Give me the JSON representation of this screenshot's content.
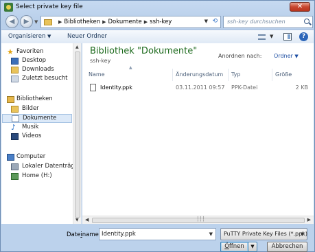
{
  "window": {
    "title": "Select private key file"
  },
  "address": {
    "crumbs": [
      "Bibliotheken",
      "Dokumente",
      "ssh-key"
    ],
    "search_placeholder": "ssh-key durchsuchen"
  },
  "toolbar": {
    "organize": "Organisieren",
    "new_folder": "Neuer Ordner"
  },
  "nav": {
    "favorites": {
      "label": "Favoriten",
      "items": [
        {
          "label": "Desktop",
          "icon": "desktop-icon"
        },
        {
          "label": "Downloads",
          "icon": "downloads-folder-icon"
        },
        {
          "label": "Zuletzt besucht",
          "icon": "recent-places-icon"
        }
      ]
    },
    "libraries": {
      "label": "Bibliotheken",
      "items": [
        {
          "label": "Bilder",
          "icon": "pictures-icon"
        },
        {
          "label": "Dokumente",
          "icon": "documents-icon",
          "selected": true
        },
        {
          "label": "Musik",
          "icon": "music-icon"
        },
        {
          "label": "Videos",
          "icon": "videos-icon"
        }
      ]
    },
    "computer": {
      "label": "Computer",
      "items": [
        {
          "label": "Lokaler Datenträg",
          "icon": "local-drive-icon"
        },
        {
          "label": "Home (H:)",
          "icon": "network-drive-icon"
        }
      ]
    }
  },
  "library": {
    "title": "Bibliothek \"Dokumente\"",
    "subtitle": "ssh-key",
    "arrange_label": "Anordnen nach:",
    "arrange_value": "Ordner"
  },
  "columns": [
    "Name",
    "Änderungsdatum",
    "Typ",
    "Größe"
  ],
  "files": [
    {
      "name": "Identity.ppk",
      "modified": "03.11.2011 09:57",
      "type": "PPK-Datei",
      "size": "2 KB"
    }
  ],
  "footer": {
    "filename_label_pre": "Date",
    "filename_label_u": "i",
    "filename_label_post": "name:",
    "filename_value": "Identity.ppk",
    "filetype_value": "PuTTY Private Key Files (*.ppk)",
    "open_pre": "",
    "open_u": "Ö",
    "open_post": "ffnen",
    "cancel": "Abbrechen"
  },
  "colors": {
    "title_green": "#1e6b1e",
    "link_blue": "#1e4fa3",
    "selection": "#dce9f8"
  }
}
